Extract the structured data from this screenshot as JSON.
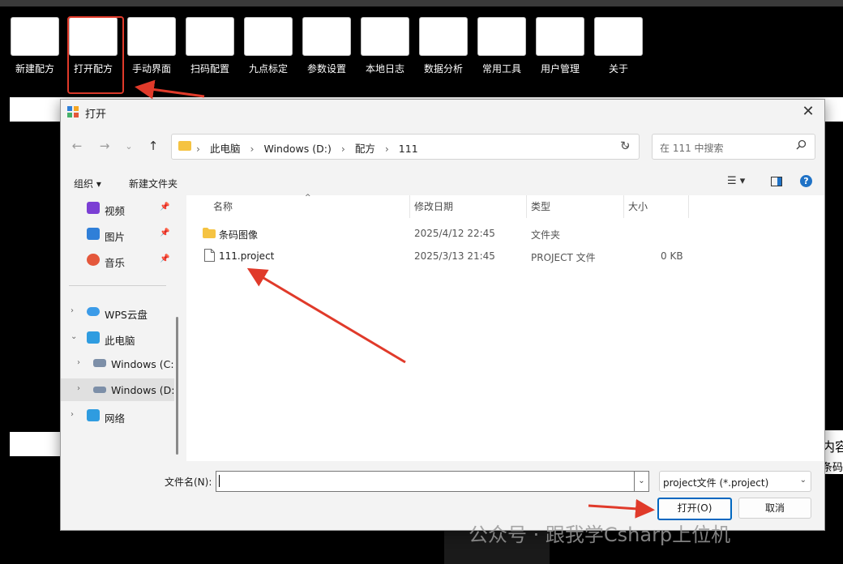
{
  "toolbar": {
    "items": [
      {
        "label": "新建配方"
      },
      {
        "label": "打开配方"
      },
      {
        "label": "手动界面"
      },
      {
        "label": "扫码配置"
      },
      {
        "label": "九点标定"
      },
      {
        "label": "参数设置"
      },
      {
        "label": "本地日志"
      },
      {
        "label": "数据分析"
      },
      {
        "label": "常用工具"
      },
      {
        "label": "用户管理"
      },
      {
        "label": "关于"
      }
    ]
  },
  "background_panel": {
    "text_line1": "内容",
    "text_line2": "条码内"
  },
  "dialog": {
    "title": "打开",
    "close_glyph": "✕",
    "breadcrumb": [
      "此电脑",
      "Windows (D:)",
      "配方",
      "111"
    ],
    "search_placeholder": "在 111 中搜索",
    "organize_label": "组织 ▾",
    "new_folder_label": "新建文件夹",
    "help_glyph": "?",
    "nav": {
      "quick": [
        {
          "label": "视频",
          "icon": "video-icon",
          "color": "#7b3fd4"
        },
        {
          "label": "图片",
          "icon": "pictures-icon",
          "color": "#2f7fd8"
        },
        {
          "label": "音乐",
          "icon": "music-icon",
          "color": "#e4573b"
        }
      ],
      "tree": [
        {
          "label": "WPS云盘",
          "icon": "cloud-icon",
          "arrow": "›"
        },
        {
          "label": "此电脑",
          "icon": "computer-icon",
          "arrow": "⌄"
        },
        {
          "label": "Windows  (C:",
          "icon": "drive-icon",
          "arrow": "›"
        },
        {
          "label": "Windows (D:)",
          "icon": "drive-icon",
          "arrow": "›"
        },
        {
          "label": "网络",
          "icon": "network-icon",
          "arrow": "›"
        }
      ]
    },
    "columns": {
      "name": "名称",
      "modified": "修改日期",
      "type": "类型",
      "size": "大小"
    },
    "files": [
      {
        "name": "条码图像",
        "modified": "2025/4/12 22:45",
        "type": "文件夹",
        "size": "",
        "icon": "folder-icon"
      },
      {
        "name": "111.project",
        "modified": "2025/3/13 21:45",
        "type": "PROJECT 文件",
        "size": "0 KB",
        "icon": "file-icon"
      }
    ],
    "filename_label": "文件名(N):",
    "filename_value": "",
    "filetype_value": "project文件 (*.project)",
    "open_button": "打开(O)",
    "cancel_button": "取消"
  },
  "watermark": "公众号 · 跟我学Csharp上位机",
  "colors": {
    "highlight": "#e03a2a",
    "accent": "#0067c0"
  }
}
